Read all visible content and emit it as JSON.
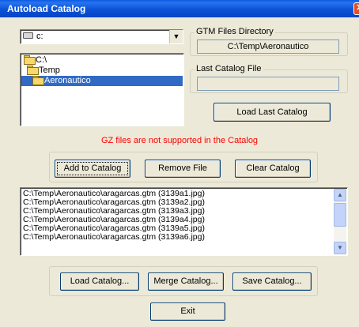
{
  "window": {
    "title": "Autoload Catalog",
    "close_glyph": "✕"
  },
  "drive": {
    "value": "c:",
    "icon": "drive-icon",
    "dropdown_glyph": "▼"
  },
  "directories": [
    {
      "label": "C:\\",
      "icon": "folder-open-icon",
      "selected": false
    },
    {
      "label": "Temp",
      "icon": "folder-open-icon",
      "selected": false
    },
    {
      "label": "Aeronautico",
      "icon": "folder-open-icon",
      "selected": true
    }
  ],
  "gtm_dir": {
    "label": "GTM Files Directory",
    "value": "C:\\Temp\\Aeronautico"
  },
  "last_catalog": {
    "label": "Last Catalog File",
    "value": ""
  },
  "buttons": {
    "load_last": "Load Last Catalog",
    "add": "Add to Catalog",
    "remove": "Remove File",
    "clear": "Clear Catalog",
    "load_catalog": "Load Catalog...",
    "merge_catalog": "Merge Catalog...",
    "save_catalog": "Save Catalog...",
    "exit": "Exit"
  },
  "notice": {
    "text": "GZ files are not supported in the Catalog",
    "color": "#ff0000"
  },
  "files": [
    "C:\\Temp\\Aeronautico\\aragarcas.gtm (3139a1.jpg)",
    "C:\\Temp\\Aeronautico\\aragarcas.gtm (3139a2.jpg)",
    "C:\\Temp\\Aeronautico\\aragarcas.gtm (3139a3.jpg)",
    "C:\\Temp\\Aeronautico\\aragarcas.gtm (3139a4.jpg)",
    "C:\\Temp\\Aeronautico\\aragarcas.gtm (3139a5.jpg)",
    "C:\\Temp\\Aeronautico\\aragarcas.gtm (3139a6.jpg)"
  ],
  "scrollbar": {
    "up_glyph": "▲",
    "down_glyph": "▼"
  },
  "colors": {
    "title_bar": "#0a52d6",
    "selection": "#316ac5",
    "window_bg": "#ece9d8"
  }
}
